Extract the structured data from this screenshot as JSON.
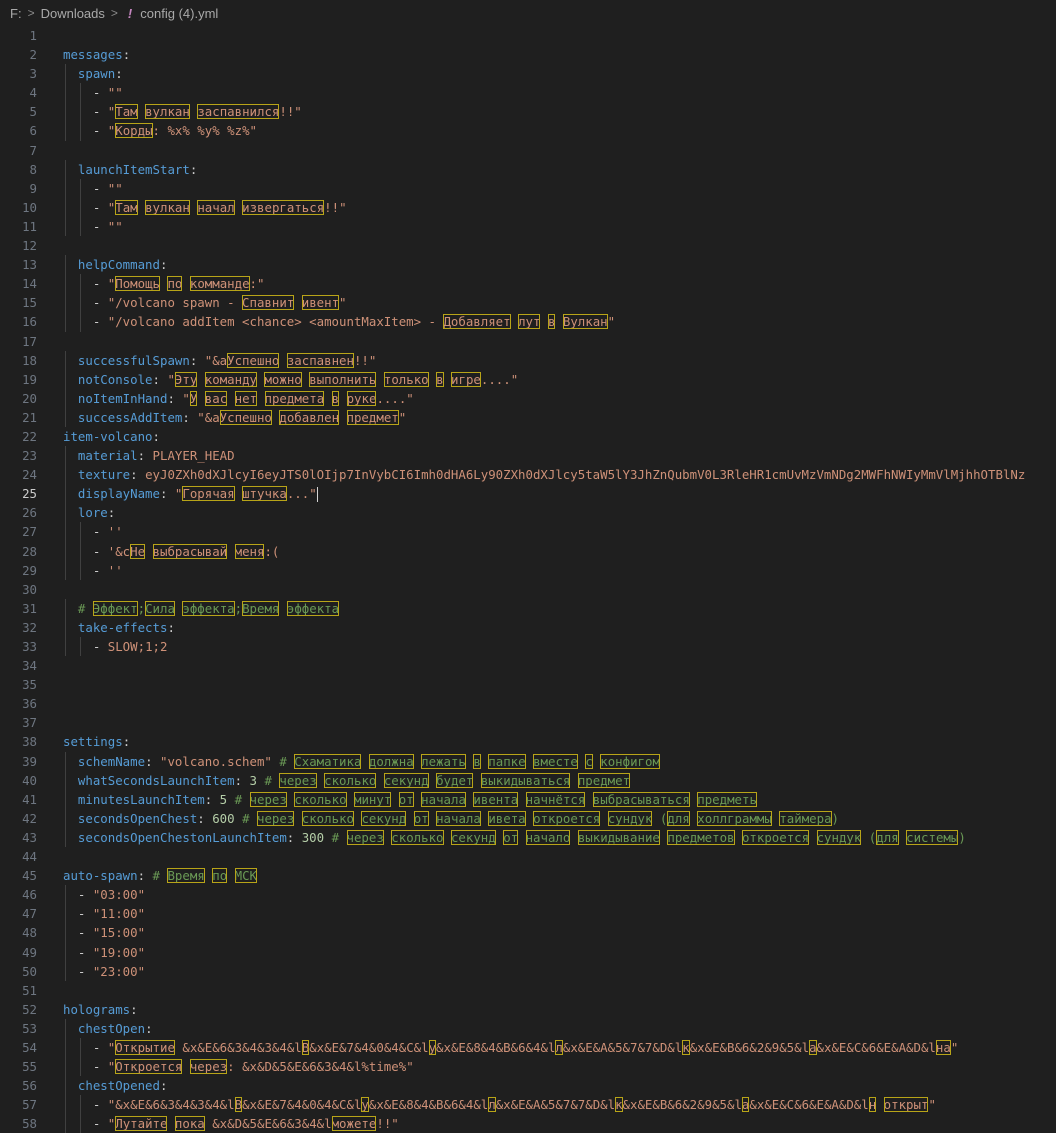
{
  "breadcrumb": {
    "drive": "F:",
    "folder": "Downloads",
    "file": "config (4).yml",
    "file_icon": "!"
  },
  "editor": {
    "current_line": 25,
    "lines": [
      [],
      [
        [
          "k",
          "messages"
        ],
        [
          "p",
          ":"
        ]
      ],
      [
        [
          "p",
          "  "
        ],
        [
          "k",
          "spawn"
        ],
        [
          "p",
          ":"
        ]
      ],
      [
        [
          "p",
          "    - "
        ],
        [
          "s",
          "\"\""
        ]
      ],
      [
        [
          "p",
          "    - "
        ],
        [
          "s",
          "\"Там вулкан заспавнился!!\""
        ]
      ],
      [
        [
          "p",
          "    - "
        ],
        [
          "s",
          "\"Корды: %x% %y% %z%\""
        ]
      ],
      [],
      [
        [
          "p",
          "  "
        ],
        [
          "k",
          "launchItemStart"
        ],
        [
          "p",
          ":"
        ]
      ],
      [
        [
          "p",
          "    - "
        ],
        [
          "s",
          "\"\""
        ]
      ],
      [
        [
          "p",
          "    - "
        ],
        [
          "s",
          "\"Там вулкан начал извергаться!!\""
        ]
      ],
      [
        [
          "p",
          "    - "
        ],
        [
          "s",
          "\"\""
        ]
      ],
      [],
      [
        [
          "p",
          "  "
        ],
        [
          "k",
          "helpCommand"
        ],
        [
          "p",
          ":"
        ]
      ],
      [
        [
          "p",
          "    - "
        ],
        [
          "s",
          "\"Помощь по комманде:\""
        ]
      ],
      [
        [
          "p",
          "    - "
        ],
        [
          "s",
          "\"/volcano spawn - Спавнит ивент\""
        ]
      ],
      [
        [
          "p",
          "    - "
        ],
        [
          "s",
          "\"/volcano addItem <chance> <amountMaxItem> - Добавляет лут в Вулкан\""
        ]
      ],
      [],
      [
        [
          "p",
          "  "
        ],
        [
          "k",
          "successfulSpawn"
        ],
        [
          "p",
          ": "
        ],
        [
          "s",
          "\"&aУспешно заспавнен!!\""
        ]
      ],
      [
        [
          "p",
          "  "
        ],
        [
          "k",
          "notConsole"
        ],
        [
          "p",
          ": "
        ],
        [
          "s",
          "\"Эту команду можно выполнить только в игре....\""
        ]
      ],
      [
        [
          "p",
          "  "
        ],
        [
          "k",
          "noItemInHand"
        ],
        [
          "p",
          ": "
        ],
        [
          "s",
          "\"У вас нет предмета в руке....\""
        ]
      ],
      [
        [
          "p",
          "  "
        ],
        [
          "k",
          "successAddItem"
        ],
        [
          "p",
          ": "
        ],
        [
          "s",
          "\"&aУспешно добавлен предмет\""
        ]
      ],
      [
        [
          "k",
          "item-volcano"
        ],
        [
          "p",
          ":"
        ]
      ],
      [
        [
          "p",
          "  "
        ],
        [
          "k",
          "material"
        ],
        [
          "p",
          ": "
        ],
        [
          "s",
          "PLAYER_HEAD"
        ]
      ],
      [
        [
          "p",
          "  "
        ],
        [
          "k",
          "texture"
        ],
        [
          "p",
          ": "
        ],
        [
          "s",
          "eyJ0ZXh0dXJlcyI6eyJTS0lOIjp7InVybCI6Imh0dHA6Ly90ZXh0dXJlcy5taW5lY3JhZnQubmV0L3RleHR1cmUvMzVmNDg2MWFhNWIyMmVlMjhhOTBlNz"
        ]
      ],
      [
        [
          "p",
          "  "
        ],
        [
          "k",
          "displayName"
        ],
        [
          "p",
          ": "
        ],
        [
          "s",
          "\"Горячая штучка...\""
        ]
      ],
      [
        [
          "p",
          "  "
        ],
        [
          "k",
          "lore"
        ],
        [
          "p",
          ":"
        ]
      ],
      [
        [
          "p",
          "    - "
        ],
        [
          "s",
          "''"
        ]
      ],
      [
        [
          "p",
          "    - "
        ],
        [
          "s",
          "'&cНе выбрасывай меня:("
        ]
      ],
      [
        [
          "p",
          "    - "
        ],
        [
          "s",
          "''"
        ]
      ],
      [],
      [
        [
          "p",
          "  "
        ],
        [
          "c",
          "# Эффект;Сила эффекта;Время эффекта"
        ]
      ],
      [
        [
          "p",
          "  "
        ],
        [
          "k",
          "take-effects"
        ],
        [
          "p",
          ":"
        ]
      ],
      [
        [
          "p",
          "    - "
        ],
        [
          "s",
          "SLOW;1;2"
        ]
      ],
      [],
      [],
      [],
      [],
      [
        [
          "k",
          "settings"
        ],
        [
          "p",
          ":"
        ]
      ],
      [
        [
          "p",
          "  "
        ],
        [
          "k",
          "schemName"
        ],
        [
          "p",
          ": "
        ],
        [
          "s",
          "\"volcano.schem\""
        ],
        [
          "p",
          " "
        ],
        [
          "c",
          "# Схаматика должна лежать в папке вместе с конфигом"
        ]
      ],
      [
        [
          "p",
          "  "
        ],
        [
          "k",
          "whatSecondsLaunchItem"
        ],
        [
          "p",
          ": "
        ],
        [
          "n",
          "3"
        ],
        [
          "p",
          " "
        ],
        [
          "c",
          "# через сколько секунд будет выкидываться предмет"
        ]
      ],
      [
        [
          "p",
          "  "
        ],
        [
          "k",
          "minutesLaunchItem"
        ],
        [
          "p",
          ": "
        ],
        [
          "n",
          "5"
        ],
        [
          "p",
          " "
        ],
        [
          "c",
          "# через сколько минут от начала ивента начнётся выбрасываться предметь"
        ]
      ],
      [
        [
          "p",
          "  "
        ],
        [
          "k",
          "secondsOpenChest"
        ],
        [
          "p",
          ": "
        ],
        [
          "n",
          "600"
        ],
        [
          "p",
          " "
        ],
        [
          "c",
          "# через сколько секунд от начала ивета откроется сундук (для холлграммы таймера)"
        ]
      ],
      [
        [
          "p",
          "  "
        ],
        [
          "k",
          "secondsOpenChestonLaunchItem"
        ],
        [
          "p",
          ": "
        ],
        [
          "n",
          "300"
        ],
        [
          "p",
          " "
        ],
        [
          "c",
          "# через сколько секунд от начало выкидывание предметов откроется сундук (для системы)"
        ]
      ],
      [],
      [
        [
          "k",
          "auto-spawn"
        ],
        [
          "p",
          ": "
        ],
        [
          "c",
          "# Время по МСК"
        ]
      ],
      [
        [
          "p",
          "  - "
        ],
        [
          "s",
          "\"03:00\""
        ]
      ],
      [
        [
          "p",
          "  - "
        ],
        [
          "s",
          "\"11:00\""
        ]
      ],
      [
        [
          "p",
          "  - "
        ],
        [
          "s",
          "\"15:00\""
        ]
      ],
      [
        [
          "p",
          "  - "
        ],
        [
          "s",
          "\"19:00\""
        ]
      ],
      [
        [
          "p",
          "  - "
        ],
        [
          "s",
          "\"23:00\""
        ]
      ],
      [],
      [
        [
          "k",
          "holograms"
        ],
        [
          "p",
          ":"
        ]
      ],
      [
        [
          "p",
          "  "
        ],
        [
          "k",
          "chestOpen"
        ],
        [
          "p",
          ":"
        ]
      ],
      [
        [
          "p",
          "    - "
        ],
        [
          "s",
          "\"Открытие &x&E&6&3&4&3&4&lВ&x&E&7&4&0&4&C&lу&x&E&8&4&B&6&4&lл&x&E&A&5&7&7&D&lк&x&E&B&6&2&9&5&lа&x&E&C&6&E&A&D&lна\""
        ]
      ],
      [
        [
          "p",
          "    - "
        ],
        [
          "s",
          "\"Откроется через: &x&D&5&E&6&3&4&l%time%\""
        ]
      ],
      [
        [
          "p",
          "  "
        ],
        [
          "k",
          "chestOpened"
        ],
        [
          "p",
          ":"
        ]
      ],
      [
        [
          "p",
          "    - "
        ],
        [
          "s",
          "\"&x&E&6&3&4&3&4&lВ&x&E&7&4&0&4&C&lу&x&E&8&4&B&6&4&lл&x&E&A&5&7&7&D&lк&x&E&B&6&2&9&5&lа&x&E&C&6&E&A&D&lн открыт\""
        ]
      ],
      [
        [
          "p",
          "    - "
        ],
        [
          "s",
          "\"Лутайте пока &x&D&5&E&6&3&4&lможете!!\""
        ]
      ]
    ]
  }
}
